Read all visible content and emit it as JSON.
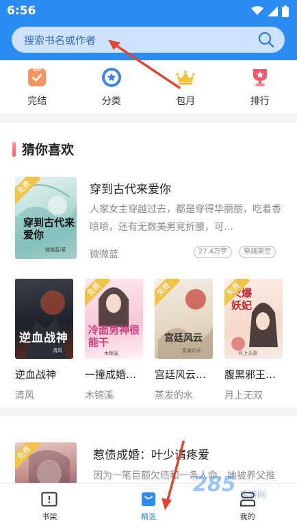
{
  "status": {
    "time": "6:56"
  },
  "search": {
    "placeholder": "搜索书名或作者",
    "icon": "search-icon"
  },
  "categories": [
    {
      "label": "完结",
      "icon": "check-book-icon",
      "color": "#f47a48"
    },
    {
      "label": "分类",
      "icon": "star-circle-icon",
      "color": "#3e83e8"
    },
    {
      "label": "包月",
      "icon": "crown-icon",
      "color": "#f5b92e"
    },
    {
      "label": "排行",
      "icon": "trophy-icon",
      "color": "#f2596b"
    }
  ],
  "section": {
    "title": "猜你喜欢",
    "free_label": "免费",
    "featured": {
      "title": "穿到古代来爱你",
      "description": "人家女主穿越过去，都是穿得华丽丽，吃着香喷喷，还有无数美男竞折腰，可…",
      "author": "微微蓝",
      "tags": [
        "27.4万字",
        "穿越架空"
      ],
      "cover_text": "穿到古代来爱你",
      "cover_author": "微微蓝/著"
    },
    "books": [
      {
        "title": "逆血战神",
        "author": "清风",
        "cover_text": "逆血战神",
        "cover_author": "清风"
      },
      {
        "title": "一撞成婚…",
        "author": "木锦溪",
        "cover_text": "冷面男神很能干",
        "cover_author": "木锦溪"
      },
      {
        "title": "宫廷风云…",
        "author": "蒸发的水",
        "cover_text": "宫廷风云",
        "cover_author": "蒸发的水"
      },
      {
        "title": "腹黑邪王…",
        "author": "月上无双",
        "cover_text": "火爆妖妃",
        "cover_author": "月上无双"
      }
    ]
  },
  "section2": {
    "free_label": "免费",
    "title": "惹债成婚：叶少请疼爱",
    "description": "因为一笔巨额欠债和一条人命，她被养父推"
  },
  "bottom_nav": [
    {
      "label": "书架",
      "icon": "bookshelf-icon",
      "active": false
    },
    {
      "label": "精选",
      "icon": "bag-icon",
      "active": true
    },
    {
      "label": "我的",
      "icon": "person-icon",
      "active": false
    }
  ],
  "watermark": {
    "text": "285",
    "sub": "手游网"
  },
  "colors": {
    "brand": "#2b8cf3",
    "annotation_arrow": "#e0452f"
  }
}
